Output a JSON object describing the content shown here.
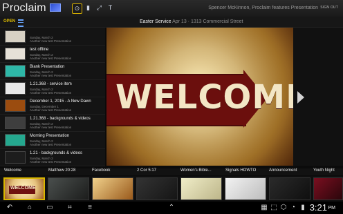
{
  "app": {
    "name": "Proclaim",
    "user_line": "Spencer McKinnon, Proclaim features Presentation",
    "sign_out": "SIGN OUT"
  },
  "toolbar": {
    "tools": [
      {
        "name": "select-tool-icon",
        "glyph": "⊙",
        "active": true
      },
      {
        "name": "slides-icon",
        "glyph": "▮",
        "active": false
      },
      {
        "name": "fullscreen-icon",
        "glyph": "⤢",
        "active": false
      },
      {
        "name": "text-icon",
        "glyph": "T",
        "active": false
      }
    ]
  },
  "subbar": {
    "open_label": "OPEN",
    "service_name": "Easter Service",
    "service_meta": "Apr 13 · 1313 Commercial Street"
  },
  "presentations": [
    {
      "title": "",
      "line1": "Sunday, March 2",
      "line2": "Another new test Presentation",
      "thumb_color": "#d7d1c4"
    },
    {
      "title": "test offline",
      "line1": "Sunday, March 2",
      "line2": "Another new test Presentation",
      "thumb_color": "#e6e1d7"
    },
    {
      "title": "Blank Presentation",
      "line1": "Sunday, March 2",
      "line2": "Another new test Presentation",
      "thumb_color": "#2eb8a8"
    },
    {
      "title": "1.21.368 - service item",
      "line1": "Sunday, March 2",
      "line2": "Another new test Presentation",
      "thumb_color": "#e8e8e8"
    },
    {
      "title": "December 1, 2015 - A New Dawn",
      "line1": "Sunday, December 1",
      "line2": "Another new test Presentation",
      "thumb_color": "#9b4c0f"
    },
    {
      "title": "1.21.368 - backgrounds & videos",
      "line1": "Sunday, March 2",
      "line2": "Another new test Presentation",
      "thumb_color": "#3e3e3e"
    },
    {
      "title": "Morning Presentation",
      "line1": "Sunday, March 2",
      "line2": "Another new test Presentation",
      "thumb_color": "#25a88f"
    },
    {
      "title": "1.21 - backgrounds & videos",
      "line1": "Sunday, March 2",
      "line2": "Another new test Presentation",
      "thumb_color": "#1d1d1d"
    }
  ],
  "stage": {
    "banner_text": "WELCOME"
  },
  "strip": [
    {
      "label": "Welcome",
      "thumb": "welcome",
      "active": true
    },
    {
      "label": "Matthew 20:28",
      "thumb": "#3b3f3e",
      "active": false
    },
    {
      "label": "Facebook",
      "thumb": "#c88a2a",
      "active": false
    },
    {
      "label": "2 Cor 5:17",
      "thumb": "#2b2b2b",
      "active": false
    },
    {
      "label": "Women's Bible...",
      "thumb": "#d8d4a6",
      "active": false
    },
    {
      "label": "Signals HOWTO",
      "thumb": "#d6d6d6",
      "active": false
    },
    {
      "label": "Announcement",
      "thumb": "#1c1c1c",
      "active": false
    },
    {
      "label": "Youth Night",
      "thumb": "#5a0b15",
      "active": false
    }
  ],
  "system": {
    "time": "3:21",
    "ampm": "PM"
  }
}
